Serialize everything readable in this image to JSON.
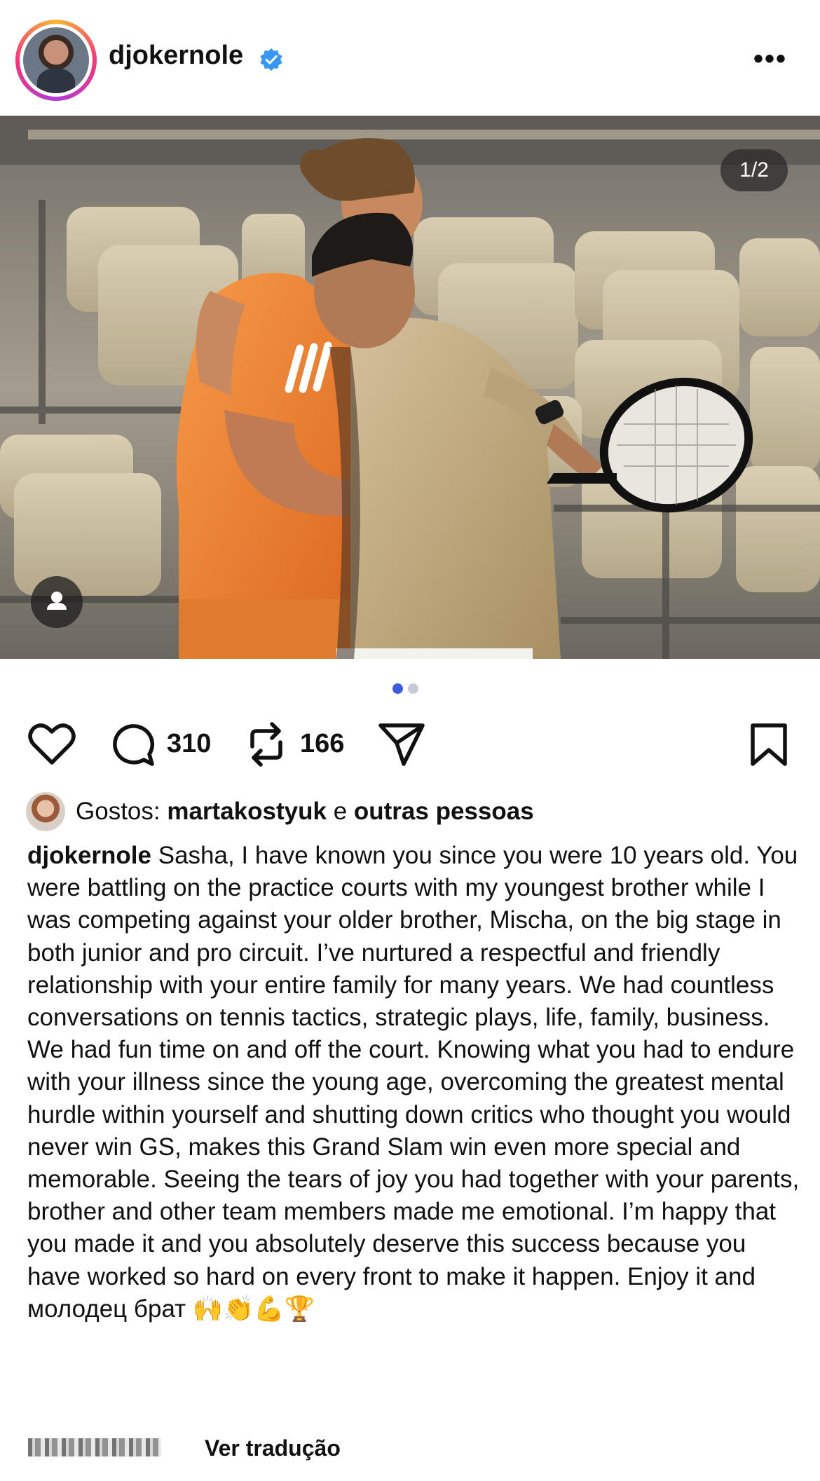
{
  "post": {
    "username": "djokernole",
    "counter": "1/2",
    "comments_count": "310",
    "reposts_count": "166"
  },
  "likes": {
    "prefix": "Gostos:",
    "user": "martakostyuk",
    "connector": "e",
    "others": "outras pessoas"
  },
  "caption": {
    "user": "djokernole",
    "text": "Sasha, I have known you since you were 10 years old. You were battling on the practice courts with my youngest brother while I was competing against your older brother, Mischa, on the big stage in both junior and pro circuit. I’ve nurtured a respectful and friendly relationship with your entire family for many years. We had countless conversations on tennis tactics, strategic plays, life, family, business. We had fun time on and off the court. Knowing what you had to endure with your illness since the young age, overcoming the greatest mental hurdle within yourself and shutting down critics who thought you would never win GS, makes this Grand Slam win even more special and memorable. Seeing the tears of joy you had together with your parents, brother and other team members made me emotional. I’m happy that you made it and you absolutely deserve this success because you have worked so hard on every front to make it happen. Enjoy it and молодец брат 🙌👏💪🏆"
  },
  "footer": {
    "translate_label": "Ver tradução"
  },
  "colors": {
    "verified": "#3897f0",
    "active_dot": "#3f5be0",
    "inactive_dot": "#c7cbd6",
    "orange_shirt": "#f08433",
    "beige_shirt": "#c3ad82"
  },
  "icons": [
    "verified-badge-icon",
    "more-icon",
    "heart-icon",
    "comment-icon",
    "repost-icon",
    "share-icon",
    "bookmark-icon",
    "user-tag-icon"
  ]
}
